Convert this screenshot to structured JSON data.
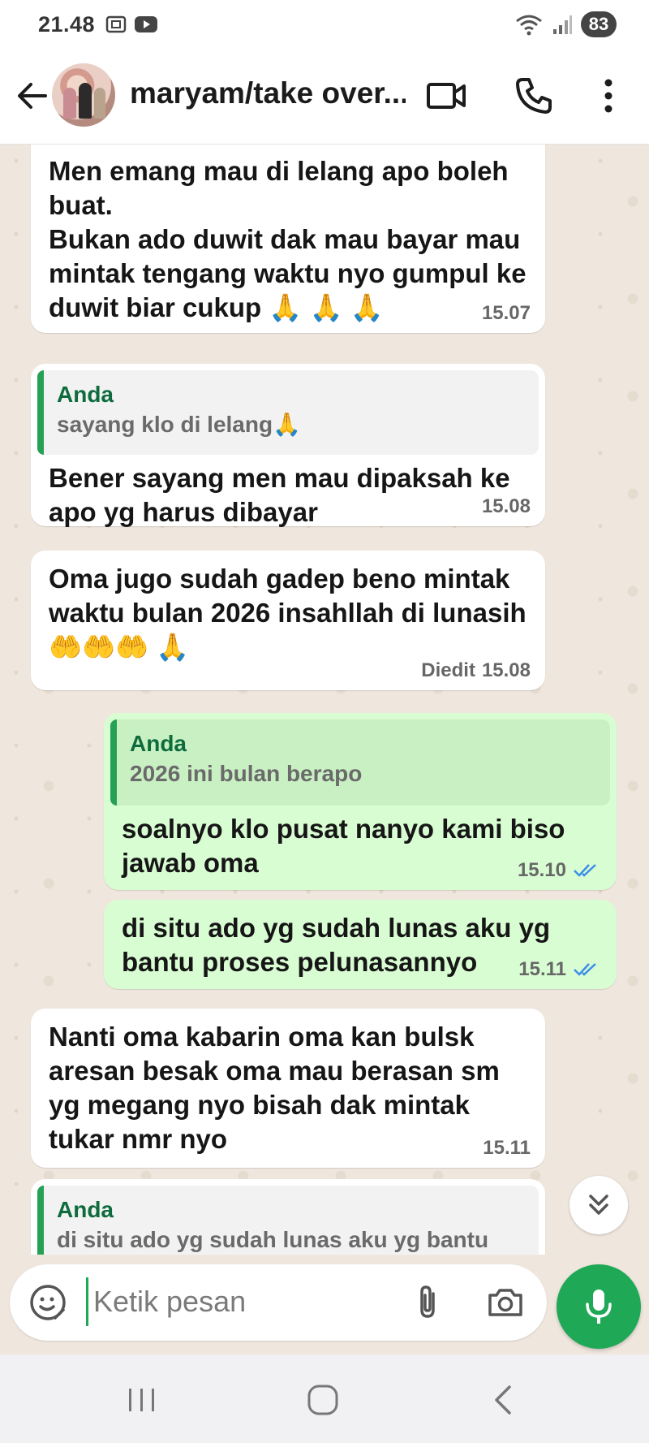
{
  "status_bar": {
    "time": "21.48",
    "battery": "83"
  },
  "header": {
    "contact_name": "maryam/take over..."
  },
  "messages": [
    {
      "direction": "in",
      "text": "Men emang mau di lelang apo boleh buat.\nBukan ado duwit dak mau bayar mau mintak tengang waktu nyo gumpul ke duwit biar cukup 🙏 🙏 🙏",
      "time": "15.07"
    },
    {
      "direction": "in",
      "quote_author": "Anda",
      "quote_text": "sayang klo di lelang🙏",
      "text": "Bener sayang men mau dipaksah ke apo yg harus dibayar",
      "time": "15.08"
    },
    {
      "direction": "in",
      "text": "Oma jugo sudah gadep  beno mintak waktu  bulan 2026 insahllah di lunasih🤲🤲🤲 🙏",
      "time": "15.08",
      "edited_label": "Diedit"
    },
    {
      "direction": "out",
      "quote_author": "Anda",
      "quote_text": "2026 ini bulan berapo",
      "text": "soalnyo klo pusat nanyo kami biso jawab oma",
      "time": "15.10"
    },
    {
      "direction": "out",
      "text": "di situ ado yg sudah lunas aku yg bantu proses pelunasannyo",
      "time": "15.11"
    },
    {
      "direction": "in",
      "text": "Nanti oma kabarin oma kan bulsk aresan besak oma mau berasan sm yg megang nyo bisah dak mintak tukar nmr nyo",
      "time": "15.11"
    },
    {
      "direction": "in",
      "quote_author": "Anda",
      "quote_text": "di situ ado yg sudah lunas aku yg bantu"
    }
  ],
  "input": {
    "placeholder": "Ketik pesan"
  },
  "colors": {
    "accent": "#1fa855",
    "outgoing_bubble": "#d9fdd3",
    "incoming_bubble": "#ffffff",
    "chat_bg": "#efe7de",
    "read_ticks": "#3b8ee8"
  }
}
